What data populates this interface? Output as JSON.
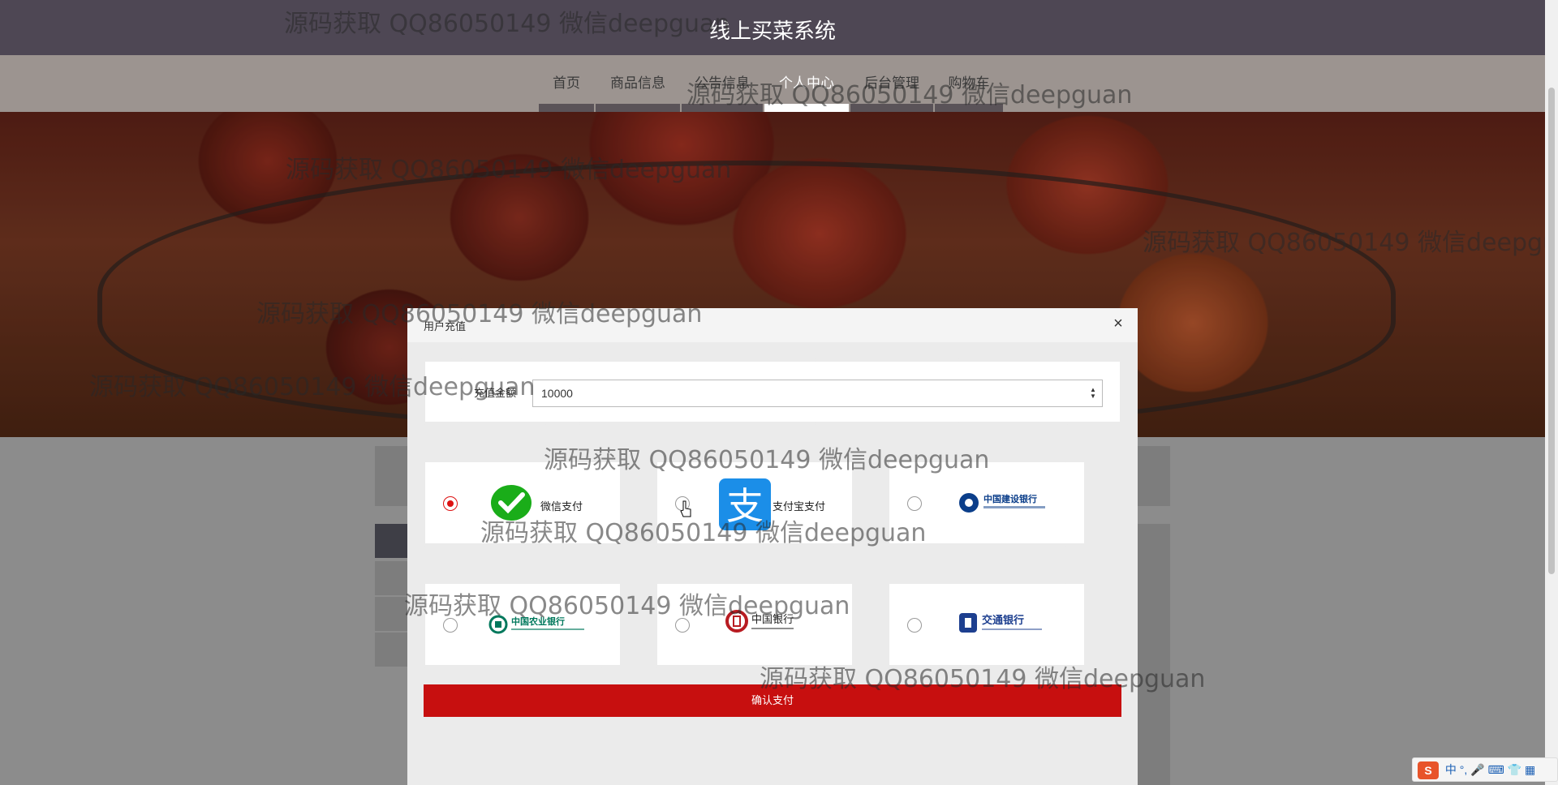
{
  "header": {
    "site_title": "线上买菜系统"
  },
  "nav": {
    "items": [
      {
        "label": "首页"
      },
      {
        "label": "商品信息"
      },
      {
        "label": "公告信息"
      },
      {
        "label": "个人中心"
      },
      {
        "label": "后台管理"
      },
      {
        "label": "购物车"
      }
    ],
    "active_index": 3
  },
  "modal": {
    "title": "用户充值",
    "close_symbol": "×",
    "amount_label": "充值金额",
    "amount_value": "10000",
    "methods": [
      {
        "label": "微信支付",
        "icon": "wechat-pay-icon",
        "checked": true
      },
      {
        "label": "支付宝支付",
        "icon": "alipay-icon",
        "checked": false
      },
      {
        "label": "中国建设银行",
        "icon": "ccb-logo",
        "checked": false
      },
      {
        "label": "中国农业银行",
        "icon": "abc-logo",
        "checked": false
      },
      {
        "label": "中国银行",
        "icon": "boc-logo",
        "checked": false
      },
      {
        "label": "交通银行",
        "icon": "bocom-logo",
        "checked": false
      }
    ],
    "confirm_label": "确认支付"
  },
  "watermark": {
    "text": "源码获取 QQ86050149 微信deepguan"
  },
  "ime": {
    "label": "中"
  },
  "colors": {
    "header_bg": "#4e4754",
    "confirm_red": "#c70f0f",
    "radio_red": "#dd1111"
  }
}
